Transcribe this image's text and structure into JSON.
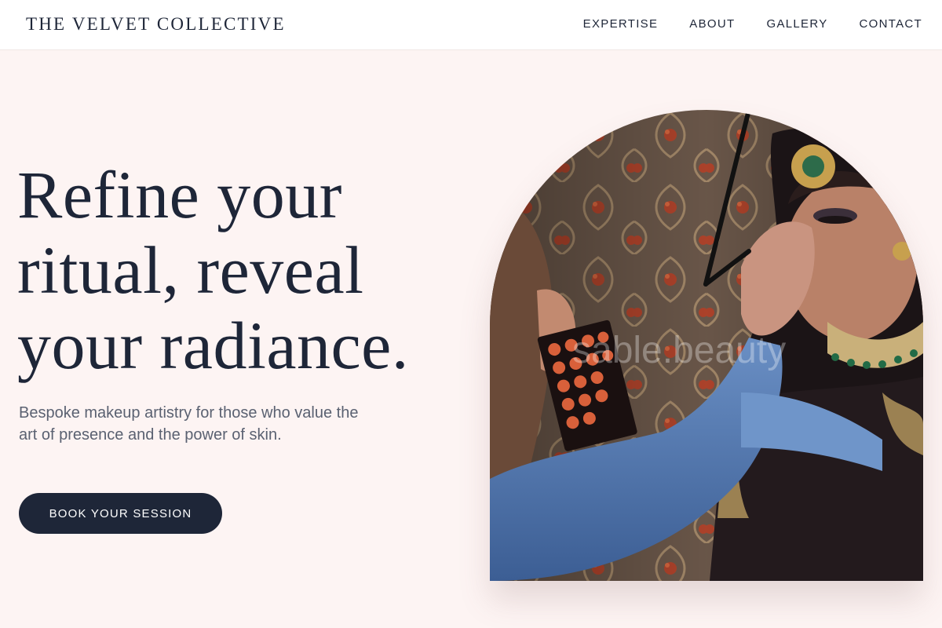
{
  "brand": {
    "name": "THE VELVET COLLECTIVE"
  },
  "nav": {
    "items": [
      {
        "label": "EXPERTISE"
      },
      {
        "label": "ABOUT"
      },
      {
        "label": "GALLERY"
      },
      {
        "label": "CONTACT"
      }
    ]
  },
  "hero": {
    "title_line1": "Refine your",
    "title_line2": "ritual, reveal",
    "title_line3": "your radiance.",
    "subtitle": "Bespoke makeup artistry for those who value the art of presence and the power of skin.",
    "cta_label": "BOOK YOUR SESSION",
    "image_watermark": "sable.beauty"
  },
  "colors": {
    "background": "#fdf4f3",
    "navy": "#1e2638",
    "subtitle": "#5a6171"
  }
}
